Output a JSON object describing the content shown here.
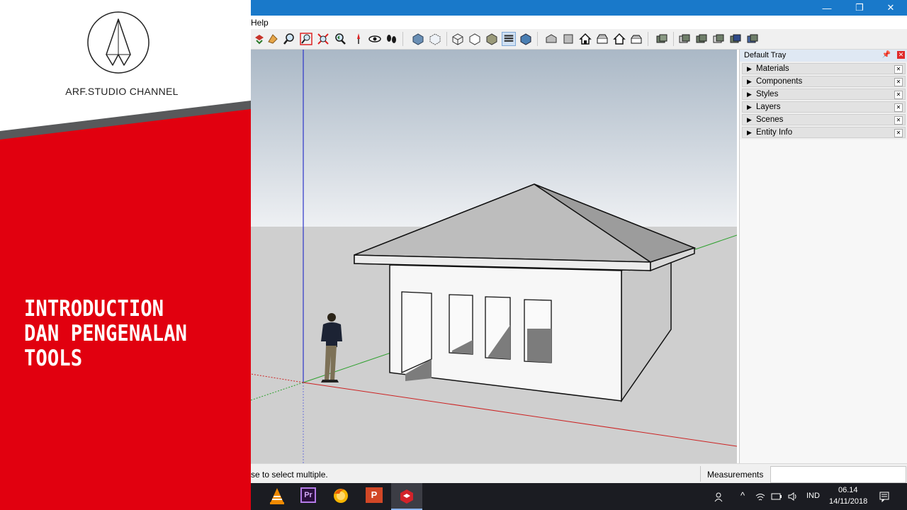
{
  "brand": {
    "channel_name": "ARF.STUDIO CHANNEL",
    "headline": [
      "INTRODUCTION",
      "DAN PENGENALAN",
      "TOOLS"
    ],
    "colors": {
      "red": "#e1000f",
      "grey_stripe": "#58595b"
    }
  },
  "window": {
    "controls": {
      "minimize": "—",
      "restore": "❐",
      "close": "✕"
    }
  },
  "menu": {
    "help_label": "Help"
  },
  "toolbar": {
    "icons": [
      "walk-icon",
      "look-around-icon",
      "zoom-icon",
      "zoom-window-icon",
      "zoom-extents-icon",
      "previous-view-icon",
      "position-camera-icon",
      "look-icon",
      "footprint-icon",
      "xray-style-icon",
      "back-edges-icon",
      "wireframe-icon",
      "hidden-line-icon",
      "shaded-icon",
      "shaded-textures-icon",
      "monochrome-icon",
      "iso-view-icon",
      "top-view-icon",
      "front-view-icon",
      "right-view-icon",
      "back-view-icon",
      "left-view-icon",
      "outer-shell-icon",
      "intersect-icon",
      "union-icon",
      "subtract-icon",
      "trim-icon",
      "split-icon"
    ]
  },
  "tray": {
    "title": "Default Tray",
    "panels": [
      "Materials",
      "Components",
      "Styles",
      "Layers",
      "Scenes",
      "Entity Info"
    ]
  },
  "status": {
    "hint": "se to select multiple.",
    "measurements_label": "Measurements",
    "measurements_value": ""
  },
  "taskbar": {
    "apps": [
      "vlc-icon",
      "premiere-icon",
      "firefox-icon",
      "powerpoint-icon",
      "sketchup-icon"
    ],
    "premiere_label": "Pr",
    "powerpoint_label": "P",
    "language": "IND",
    "time": "06.14",
    "date": "14/11/2018"
  }
}
